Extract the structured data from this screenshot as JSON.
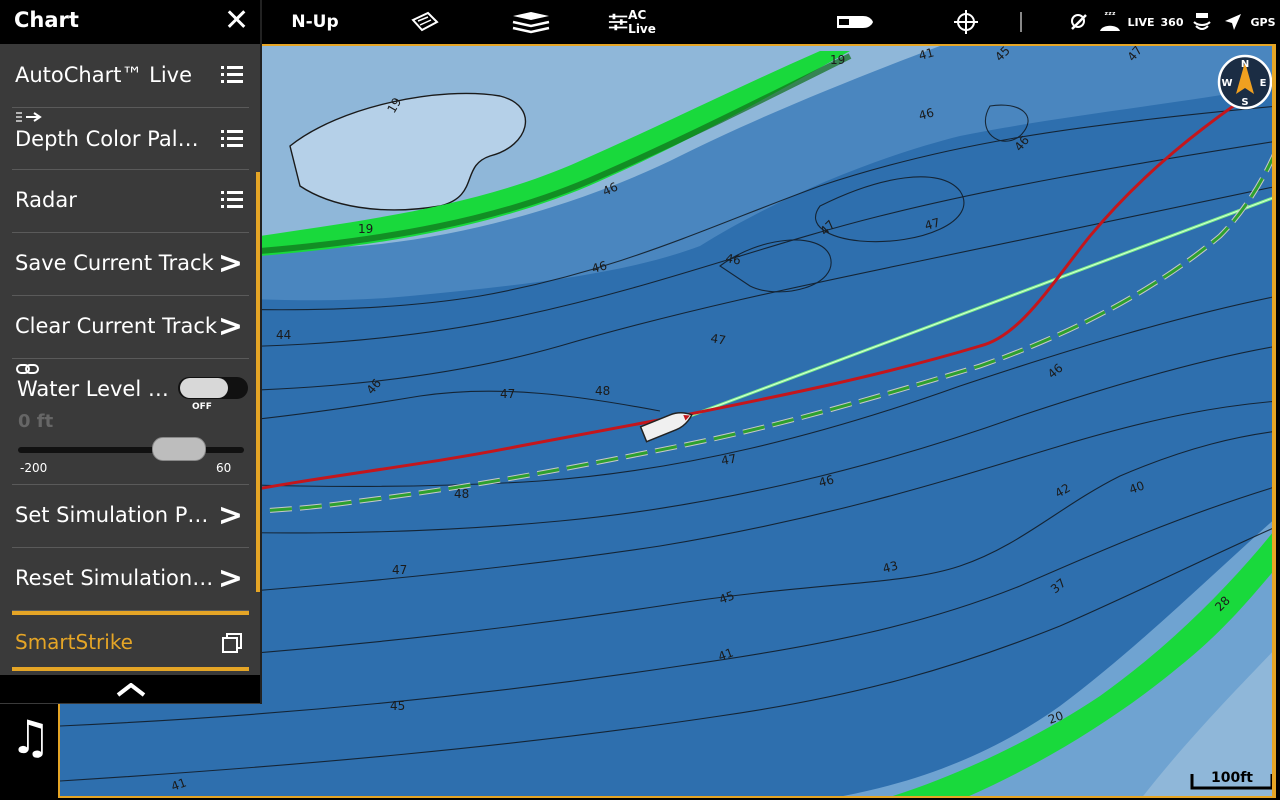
{
  "menu": {
    "title": "Chart",
    "items": [
      {
        "label": "AutoChart™ Live",
        "icon": "list-icon"
      },
      {
        "label": "Depth Color Pal…",
        "icon": "list-icon"
      },
      {
        "label": "Radar",
        "icon": "list-icon"
      },
      {
        "label": "Save Current Track",
        "icon": "chevron-right-icon"
      },
      {
        "label": "Clear Current Track",
        "icon": "chevron-right-icon"
      },
      {
        "label": "Set Simulation P…",
        "icon": "chevron-right-icon"
      },
      {
        "label": "Reset Simulation…",
        "icon": "chevron-right-icon"
      }
    ],
    "water_level": {
      "label": "Water Level …",
      "toggle_state": "OFF",
      "value": "0 ft",
      "slider_min": "-200",
      "slider_max": "60",
      "slider_level": 0.77
    },
    "smartstrike": "SmartStrike",
    "accent_color": "#e5a526"
  },
  "toolbar": {
    "orientation": "N-Up",
    "ac_live": "AC Live",
    "live": "LIVE",
    "three_sixty": "360",
    "gps": "GPS"
  },
  "map": {
    "depth_labels": [
      "19",
      "41",
      "45",
      "47",
      "46",
      "46",
      "47",
      "19",
      "19",
      "46",
      "47",
      "46",
      "46",
      "44",
      "47",
      "46",
      "47",
      "48",
      "46",
      "47",
      "46",
      "42",
      "40",
      "48",
      "47",
      "43",
      "37",
      "45",
      "28",
      "41",
      "45",
      "20",
      "41"
    ],
    "scale": "100ft",
    "compass": {
      "n": "N",
      "e": "E",
      "s": "S",
      "w": "W"
    }
  }
}
